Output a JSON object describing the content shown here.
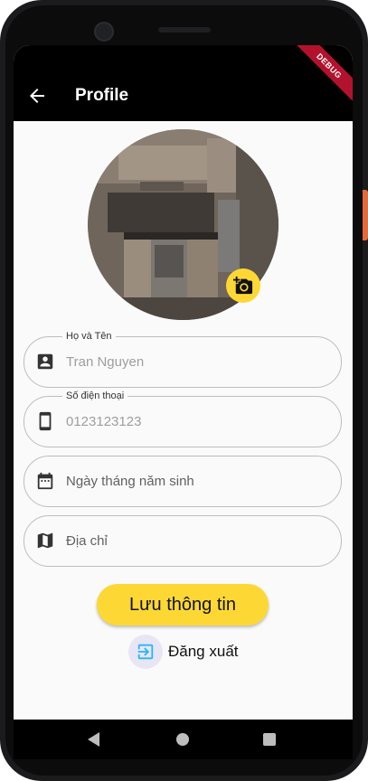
{
  "appbar": {
    "title": "Profile",
    "debug_label": "DEBUG"
  },
  "avatar": {
    "icon": "kitchen-photo"
  },
  "fields": [
    {
      "label": "Họ và Tên",
      "value": "Tran Nguyen",
      "icon": "contact-card-icon"
    },
    {
      "label": "Số điện thoại",
      "value": "0123123123",
      "icon": "smartphone-icon"
    },
    {
      "label": "",
      "placeholder": "Ngày tháng năm sinh",
      "icon": "calendar-icon"
    },
    {
      "label": "",
      "placeholder": "Địa chỉ",
      "icon": "map-icon"
    }
  ],
  "actions": {
    "save_label": "Lưu thông tin",
    "logout_label": "Đăng xuất"
  },
  "colors": {
    "accent": "#fdd835",
    "appbar": "#000000",
    "logout_icon": "#29b6f6"
  }
}
